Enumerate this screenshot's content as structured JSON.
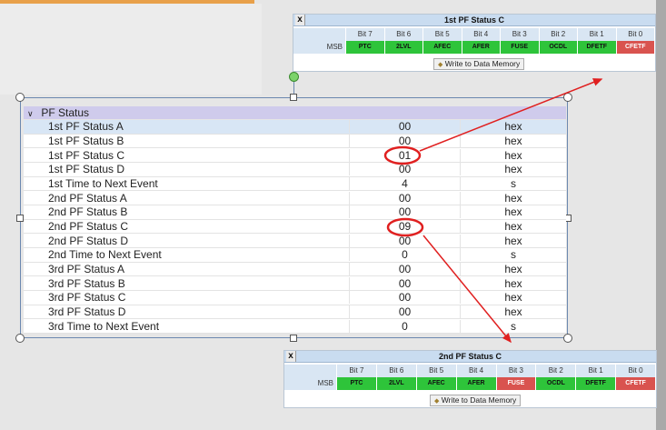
{
  "panel1": {
    "title": "1st PF Status C",
    "close_label": "x",
    "row_label": "MSB",
    "bits": [
      "Bit 7",
      "Bit 6",
      "Bit 5",
      "Bit 4",
      "Bit 3",
      "Bit 2",
      "Bit 1",
      "Bit 0"
    ],
    "flags": [
      {
        "name": "PTC",
        "state": "green"
      },
      {
        "name": "2LVL",
        "state": "green"
      },
      {
        "name": "AFEC",
        "state": "green"
      },
      {
        "name": "AFER",
        "state": "green"
      },
      {
        "name": "FUSE",
        "state": "green"
      },
      {
        "name": "OCDL",
        "state": "green"
      },
      {
        "name": "DFETF",
        "state": "green"
      },
      {
        "name": "CFETF",
        "state": "red"
      }
    ],
    "write_label": "Write to Data Memory"
  },
  "panel2": {
    "title": "2nd PF Status C",
    "close_label": "x",
    "row_label": "MSB",
    "bits": [
      "Bit 7",
      "Bit 6",
      "Bit 5",
      "Bit 4",
      "Bit 3",
      "Bit 2",
      "Bit 1",
      "Bit 0"
    ],
    "flags": [
      {
        "name": "PTC",
        "state": "green"
      },
      {
        "name": "2LVL",
        "state": "green"
      },
      {
        "name": "AFEC",
        "state": "green"
      },
      {
        "name": "AFER",
        "state": "green"
      },
      {
        "name": "FUSE",
        "state": "red"
      },
      {
        "name": "OCDL",
        "state": "green"
      },
      {
        "name": "DFETF",
        "state": "green"
      },
      {
        "name": "CFETF",
        "state": "red"
      }
    ],
    "write_label": "Write to Data Memory"
  },
  "grid": {
    "category": "PF Status",
    "rows": [
      {
        "name": "1st PF Status A",
        "value": "00",
        "unit": "hex"
      },
      {
        "name": "1st PF Status B",
        "value": "00",
        "unit": "hex"
      },
      {
        "name": "1st PF Status C",
        "value": "01",
        "unit": "hex"
      },
      {
        "name": "1st PF Status D",
        "value": "00",
        "unit": "hex"
      },
      {
        "name": "1st Time to Next Event",
        "value": "4",
        "unit": "s"
      },
      {
        "name": "2nd PF Status A",
        "value": "00",
        "unit": "hex"
      },
      {
        "name": "2nd PF Status B",
        "value": "00",
        "unit": "hex"
      },
      {
        "name": "2nd PF Status C",
        "value": "09",
        "unit": "hex"
      },
      {
        "name": "2nd PF Status D",
        "value": "00",
        "unit": "hex"
      },
      {
        "name": "2nd Time to Next Event",
        "value": "0",
        "unit": "s"
      },
      {
        "name": "3rd PF Status A",
        "value": "00",
        "unit": "hex"
      },
      {
        "name": "3rd PF Status B",
        "value": "00",
        "unit": "hex"
      },
      {
        "name": "3rd PF Status C",
        "value": "00",
        "unit": "hex"
      },
      {
        "name": "3rd PF Status D",
        "value": "00",
        "unit": "hex"
      },
      {
        "name": "3rd Time to Next Event",
        "value": "0",
        "unit": "s"
      }
    ]
  },
  "colors": {
    "flag_ok": "#2ec43a",
    "flag_set": "#d9534f",
    "annotation": "#e02020",
    "category_bg": "#cfcbec"
  }
}
